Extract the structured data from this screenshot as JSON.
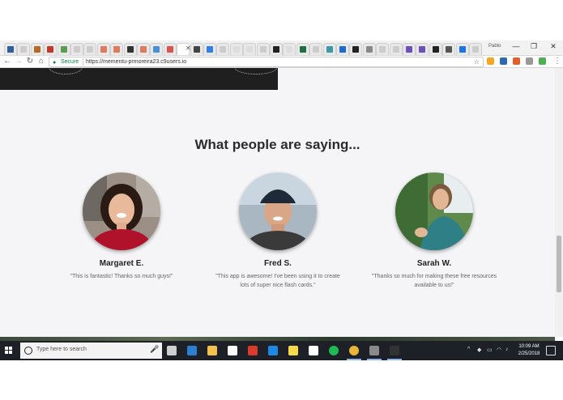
{
  "browser": {
    "tabs": [
      {
        "icon": "slack-icon",
        "color": "#2d5f9a"
      },
      {
        "icon": "page-icon",
        "color": "#cccccc"
      },
      {
        "icon": "github-cat-icon",
        "color": "#b46b2a"
      },
      {
        "icon": "red-square-icon",
        "color": "#c0392b"
      },
      {
        "icon": "sheet-icon",
        "color": "#5a9e4a"
      },
      {
        "icon": "page-icon",
        "color": "#cccccc"
      },
      {
        "icon": "page-icon",
        "color": "#cccccc"
      },
      {
        "icon": "wave-icon",
        "color": "#e07a5f"
      },
      {
        "icon": "wave-icon",
        "color": "#e07a5f"
      },
      {
        "icon": "bar-icon",
        "color": "#333333"
      },
      {
        "icon": "wave-icon",
        "color": "#e07a5f"
      },
      {
        "icon": "mail-icon",
        "color": "#4a90d9"
      },
      {
        "icon": "image-icon",
        "color": "#d9534f"
      },
      {
        "icon": "c9-icon",
        "color": "#ffffff"
      },
      {
        "icon": "keyboard-icon",
        "color": "#444444"
      },
      {
        "icon": "cloud-icon",
        "color": "#2f80ed"
      },
      {
        "icon": "page-icon",
        "color": "#cccccc"
      },
      {
        "icon": "google-icon",
        "color": "#dddddd"
      },
      {
        "icon": "google-icon",
        "color": "#dddddd"
      },
      {
        "icon": "page-icon",
        "color": "#cccccc"
      },
      {
        "icon": "github-icon",
        "color": "#222222"
      },
      {
        "icon": "google-icon",
        "color": "#dddddd"
      },
      {
        "icon": "c-icon",
        "color": "#1f6f43"
      },
      {
        "icon": "page-icon",
        "color": "#cccccc"
      },
      {
        "icon": "netlify-icon",
        "color": "#3b9aa6"
      },
      {
        "icon": "dropbox-icon",
        "color": "#1f6ad1"
      },
      {
        "icon": "github-icon",
        "color": "#222222"
      },
      {
        "icon": "link-icon",
        "color": "#888888"
      },
      {
        "icon": "page-icon",
        "color": "#cccccc"
      },
      {
        "icon": "page-icon",
        "color": "#cccccc"
      },
      {
        "icon": "slack-hash-icon",
        "color": "#6b4fbb"
      },
      {
        "icon": "slack-hash-icon",
        "color": "#6b4fbb"
      },
      {
        "icon": "terminal-icon",
        "color": "#222222"
      },
      {
        "icon": "square-icon",
        "color": "#555555"
      },
      {
        "icon": "circle-icon",
        "color": "#1a73e8"
      },
      {
        "icon": "page-icon",
        "color": "#cccccc"
      }
    ],
    "profile_label": "Pablo",
    "address": {
      "secure_label": "Secure",
      "url": "https://mementu-prmoreira23.c9users.io"
    },
    "extensions": [
      {
        "icon": "extension-orange-icon",
        "color": "#f5a623"
      },
      {
        "icon": "extension-blue-icon",
        "color": "#2b6cb0"
      },
      {
        "icon": "extension-red-icon",
        "color": "#e25c2c"
      },
      {
        "icon": "extension-gray-icon",
        "color": "#9a9a9a"
      },
      {
        "icon": "extension-green-icon",
        "color": "#4caf50"
      }
    ]
  },
  "page": {
    "headline": "What people are saying...",
    "testimonials": [
      {
        "name": "Margaret E.",
        "quote": "\"This is fantastic! Thanks so much guys!\""
      },
      {
        "name": "Fred S.",
        "quote": "\"This app is awesome! I've been using it to create lots of super nice flash cards.\""
      },
      {
        "name": "Sarah W.",
        "quote": "\"Thanks so much for making these free resources available to us!\""
      }
    ]
  },
  "taskbar": {
    "search_placeholder": "Type here to search",
    "apps": [
      {
        "icon": "task-view-icon",
        "color": "#cfcfcf"
      },
      {
        "icon": "edge-icon",
        "color": "#2d7fd3"
      },
      {
        "icon": "file-explorer-icon",
        "color": "#f2c14e"
      },
      {
        "icon": "store-icon",
        "color": "#ffffff"
      },
      {
        "icon": "app-red-icon",
        "color": "#d83b2b"
      },
      {
        "icon": "app-blue-l-icon",
        "color": "#1e88e5"
      },
      {
        "icon": "sticky-notes-icon",
        "color": "#f7d94c"
      },
      {
        "icon": "mail-icon",
        "color": "#ffffff"
      },
      {
        "icon": "spotify-icon",
        "color": "#1db954"
      },
      {
        "icon": "chrome-icon",
        "color": "#e8b43a"
      },
      {
        "icon": "photos-icon",
        "color": "#8a8a8a"
      },
      {
        "icon": "terminal-icon",
        "color": "#333333"
      }
    ],
    "time": "10:09 AM",
    "date": "2/25/2018"
  }
}
